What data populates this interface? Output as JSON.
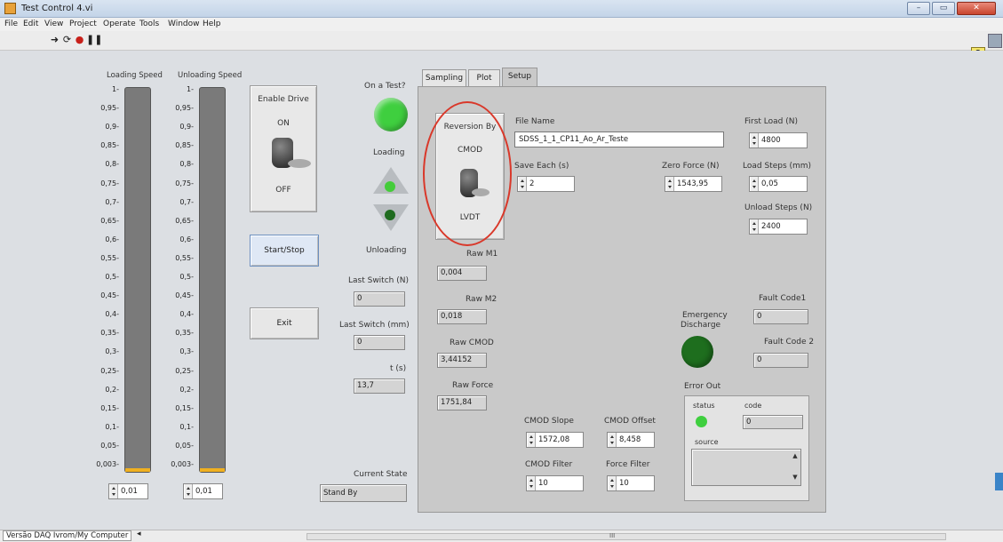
{
  "window": {
    "title": "Test Control 4.vi",
    "controls": [
      "–",
      "▭",
      "✕"
    ]
  },
  "menu": [
    "File",
    "Edit",
    "View",
    "Project",
    "Operate",
    "Tools",
    "Window",
    "Help"
  ],
  "toolbar": {
    "icons": [
      "run-arrow-icon",
      "run-continuous-icon",
      "abort-icon",
      "pause-icon"
    ],
    "help": "?"
  },
  "meters": {
    "loading": {
      "label": "Loading Speed",
      "ticks": [
        "1-",
        "0,95-",
        "0,9-",
        "0,85-",
        "0,8-",
        "0,75-",
        "0,7-",
        "0,65-",
        "0,6-",
        "0,55-",
        "0,5-",
        "0,45-",
        "0,4-",
        "0,35-",
        "0,3-",
        "0,25-",
        "0,2-",
        "0,15-",
        "0,1-",
        "0,05-",
        "0,003-"
      ],
      "value": "0,01",
      "level": 0.01
    },
    "unloading": {
      "label": "Unloading Speed",
      "ticks": [
        "1-",
        "0,95-",
        "0,9-",
        "0,85-",
        "0,8-",
        "0,75-",
        "0,7-",
        "0,65-",
        "0,6-",
        "0,55-",
        "0,5-",
        "0,45-",
        "0,4-",
        "0,35-",
        "0,3-",
        "0,25-",
        "0,2-",
        "0,15-",
        "0,1-",
        "0,05-",
        "0,003-"
      ],
      "value": "0,01",
      "level": 0.01
    }
  },
  "enable_drive": {
    "label": "Enable Drive",
    "on": "ON",
    "off": "OFF"
  },
  "start_stop": "Start/Stop",
  "exit": "Exit",
  "on_test": {
    "label": "On a Test?",
    "color": "#3fcf3f"
  },
  "loading_lbl": "Loading",
  "unloading_lbl": "Unloading",
  "last_switch_n": {
    "label": "Last Switch (N)",
    "value": "0"
  },
  "last_switch_mm": {
    "label": "Last Switch (mm)",
    "value": "0"
  },
  "time": {
    "label": "t (s)",
    "value": "13,7"
  },
  "current_state": {
    "label": "Current State",
    "value": "Stand By"
  },
  "tabs": [
    "Sampling",
    "Plot",
    "Setup"
  ],
  "reversion": {
    "label": "Reversion By",
    "top": "CMOD",
    "bottom": "LVDT"
  },
  "file_name": {
    "label": "File Name",
    "value": "SDSS_1_1_CP11_Ao_Ar_Teste"
  },
  "save_each": {
    "label": "Save Each (s)",
    "value": "2"
  },
  "zero_force": {
    "label": "Zero Force (N)",
    "value": "1543,95"
  },
  "first_load": {
    "label": "First Load (N)",
    "value": "4800"
  },
  "load_steps": {
    "label": "Load Steps (mm)",
    "value": "0,05"
  },
  "unload_steps": {
    "label": "Unload Steps (N)",
    "value": "2400"
  },
  "raw_m1": {
    "label": "Raw M1",
    "value": "0,004"
  },
  "raw_m2": {
    "label": "Raw M2",
    "value": "0,018"
  },
  "raw_cmod": {
    "label": "Raw CMOD",
    "value": "3,44152"
  },
  "raw_force": {
    "label": "Raw Force",
    "value": "1751,84"
  },
  "cmod_slope": {
    "label": "CMOD Slope",
    "value": "1572,08"
  },
  "cmod_offset": {
    "label": "CMOD Offset",
    "value": "8,458"
  },
  "cmod_filter": {
    "label": "CMOD Filter",
    "value": "10"
  },
  "force_filter": {
    "label": "Force Filter",
    "value": "10"
  },
  "emergency": {
    "label1": "Emergency",
    "label2": "Discharge",
    "color": "#1e6e1e"
  },
  "fault1": {
    "label": "Fault Code1",
    "value": "0"
  },
  "fault2": {
    "label": "Fault Code 2",
    "value": "0"
  },
  "error_out": {
    "label": "Error Out",
    "status_label": "status",
    "code_label": "code",
    "code_value": "0",
    "source_label": "source",
    "status_color": "#3fcf3f"
  },
  "status_bar": {
    "path": "Versão DAQ Ivrom/My Computer",
    "scroll_mark": "III"
  }
}
